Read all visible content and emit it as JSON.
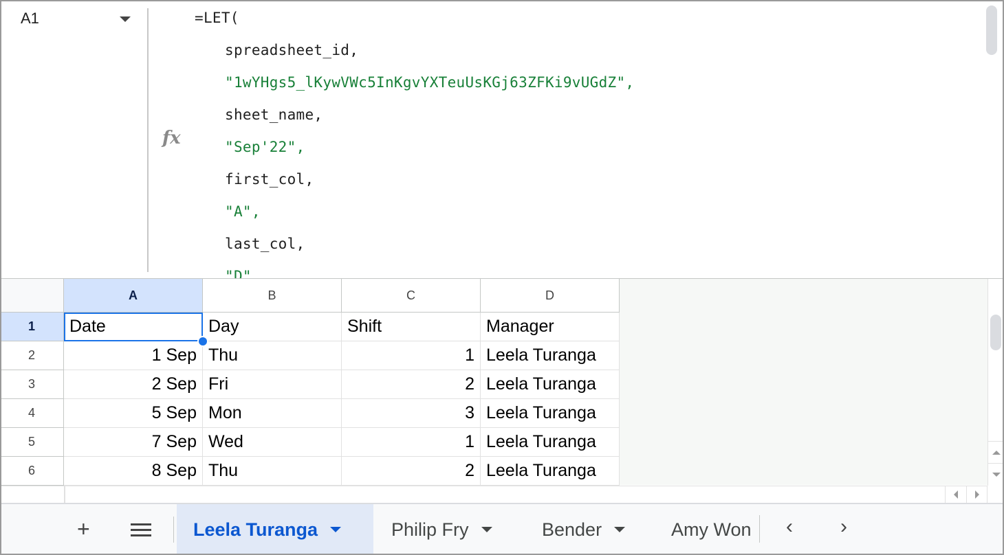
{
  "formula_bar": {
    "name_box": "A1",
    "fx_label": "fx",
    "lines": [
      {
        "text": "=LET(",
        "type": "code",
        "indent": 0
      },
      {
        "text": "spreadsheet_id,",
        "type": "code",
        "indent": 1
      },
      {
        "text": "\"1wYHgs5_lKywVWc5InKgvYXTeuUsKGj63ZFKi9vUGdZ\",",
        "type": "string",
        "indent": 1
      },
      {
        "text": "sheet_name,",
        "type": "code",
        "indent": 1
      },
      {
        "text": "\"Sep'22\",",
        "type": "string",
        "indent": 1
      },
      {
        "text": "first_col,",
        "type": "code",
        "indent": 1
      },
      {
        "text": "\"A\",",
        "type": "string",
        "indent": 1
      },
      {
        "text": "last_col,",
        "type": "code",
        "indent": 1
      },
      {
        "text": "\"D\"",
        "type": "string",
        "indent": 1
      }
    ]
  },
  "grid": {
    "columns": [
      "A",
      "B",
      "C",
      "D"
    ],
    "selected_cell": "A1",
    "rows": [
      {
        "n": "1",
        "cells": [
          "Date",
          "Day",
          "Shift",
          "Manager"
        ]
      },
      {
        "n": "2",
        "cells": [
          "1 Sep",
          "Thu",
          "1",
          "Leela Turanga"
        ]
      },
      {
        "n": "3",
        "cells": [
          "2 Sep",
          "Fri",
          "2",
          "Leela Turanga"
        ]
      },
      {
        "n": "4",
        "cells": [
          "5 Sep",
          "Mon",
          "3",
          "Leela Turanga"
        ]
      },
      {
        "n": "5",
        "cells": [
          "7 Sep",
          "Wed",
          "1",
          "Leela Turanga"
        ]
      },
      {
        "n": "6",
        "cells": [
          "8 Sep",
          "Thu",
          "2",
          "Leela Turanga"
        ]
      }
    ]
  },
  "sheet_tabs": {
    "add_icon": "plus-icon",
    "list_icon": "menu-icon",
    "tabs": [
      {
        "label": "Leela Turanga",
        "active": true
      },
      {
        "label": "Philip Fry",
        "active": false
      },
      {
        "label": "Bender",
        "active": false
      },
      {
        "label": "Amy Won",
        "active": false
      }
    ]
  },
  "colors": {
    "accent": "#0b57d0",
    "selected_header": "#d3e3fd",
    "active_tab": "#e1e9f7",
    "string": "#188038"
  }
}
